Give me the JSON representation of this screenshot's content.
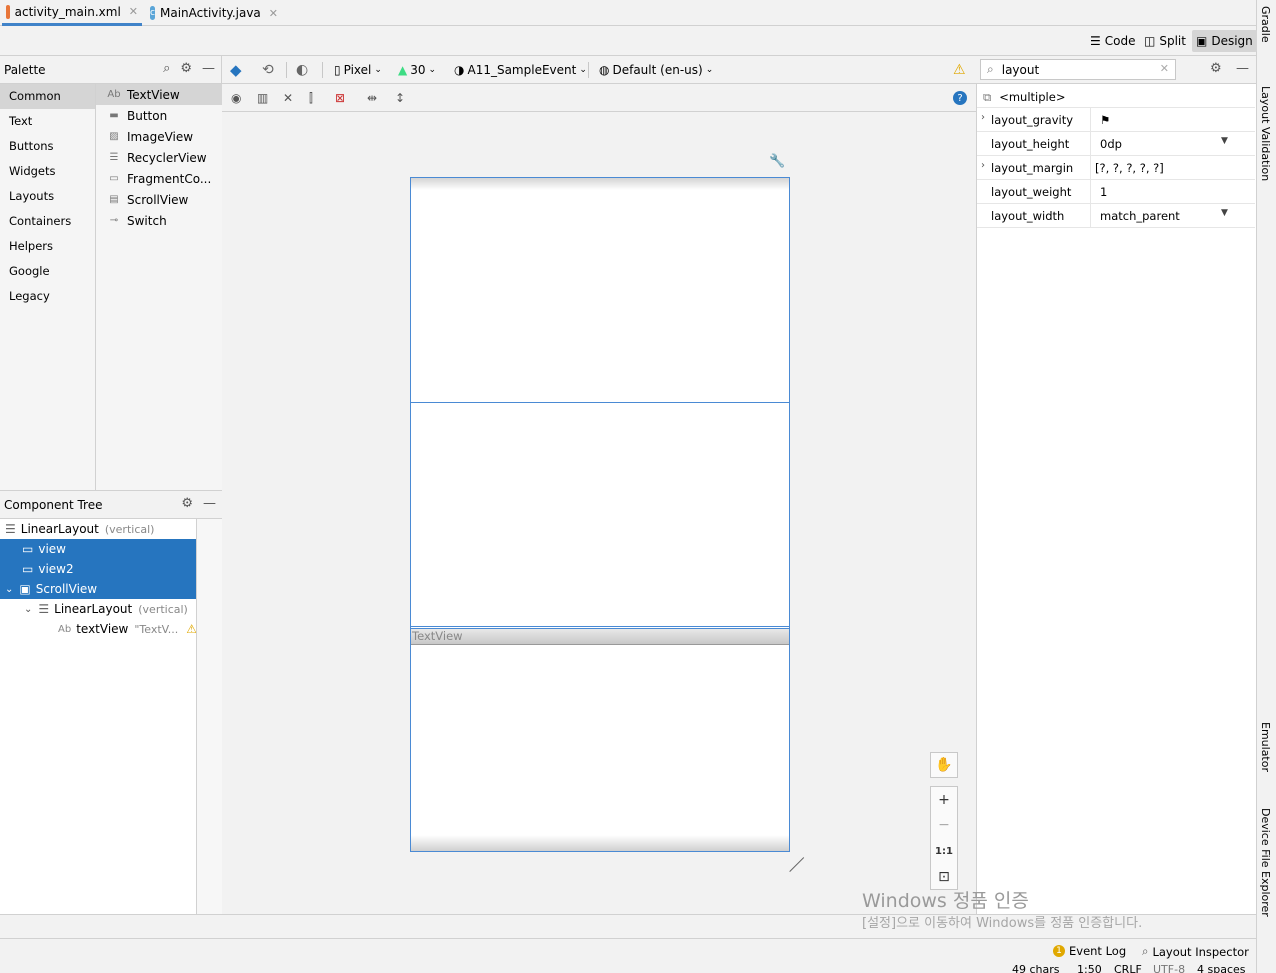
{
  "editor_tabs": [
    {
      "label": "activity_main.xml",
      "active": true
    },
    {
      "label": "MainActivity.java",
      "active": false
    }
  ],
  "view_modes": {
    "code": "Code",
    "split": "Split",
    "design": "Design",
    "active": "Design"
  },
  "palette": {
    "title": "Palette",
    "categories": [
      "Common",
      "Text",
      "Buttons",
      "Widgets",
      "Layouts",
      "Containers",
      "Helpers",
      "Google",
      "Legacy"
    ],
    "selected_category": "Common",
    "items": [
      {
        "label": "TextView",
        "icon": "Ab"
      },
      {
        "label": "Button",
        "icon": "button-icon"
      },
      {
        "label": "ImageView",
        "icon": "image-icon"
      },
      {
        "label": "RecyclerView",
        "icon": "list-icon"
      },
      {
        "label": "FragmentCo...",
        "icon": "fragment-icon"
      },
      {
        "label": "ScrollView",
        "icon": "scroll-icon"
      },
      {
        "label": "Switch",
        "icon": "switch-icon"
      }
    ]
  },
  "component_tree": {
    "title": "Component Tree",
    "nodes": [
      {
        "label": "LinearLayout",
        "hint": "(vertical)"
      },
      {
        "label": "view",
        "hint": ""
      },
      {
        "label": "view2",
        "hint": ""
      },
      {
        "label": "ScrollView",
        "hint": ""
      },
      {
        "label": "LinearLayout",
        "hint": "(vertical)"
      },
      {
        "label": "textView",
        "hint": "\"TextV..."
      }
    ]
  },
  "design_toolbar": {
    "device": "Pixel",
    "api": "30",
    "theme": "A11_SampleEvent",
    "locale": "Default (en-us)"
  },
  "canvas": {
    "textview_label": "TextView"
  },
  "zoom": {
    "plus": "+",
    "minus": "−",
    "one_to_one": "1:1"
  },
  "attributes": {
    "search_value": "layout",
    "selection": "<multiple>",
    "rows": [
      {
        "name": "layout_gravity",
        "value": "⚑",
        "expandable": true
      },
      {
        "name": "layout_height",
        "value": "0dp",
        "expandable": false
      },
      {
        "name": "layout_margin",
        "value": "[?, ?, ?, ?, ?]",
        "expandable": true
      },
      {
        "name": "layout_weight",
        "value": "1",
        "expandable": false
      },
      {
        "name": "layout_width",
        "value": "match_parent",
        "expandable": false
      }
    ]
  },
  "side_tools": {
    "gradle": "Gradle",
    "layout_validation": "Layout Validation",
    "emulator": "Emulator",
    "device_file_explorer": "Device File Explorer"
  },
  "bottom_tools": {
    "event_log": "Event Log",
    "event_log_count": "1",
    "layout_inspector": "Layout Inspector"
  },
  "status": {
    "chars": "49 chars",
    "position": "1:50",
    "line_sep": "CRLF",
    "encoding": "UTF-8",
    "indent": "4 spaces"
  },
  "watermark": {
    "line1": "Windows 정품 인증",
    "line2": "[설정]으로 이동하여 Windows를 정품 인증합니다."
  }
}
